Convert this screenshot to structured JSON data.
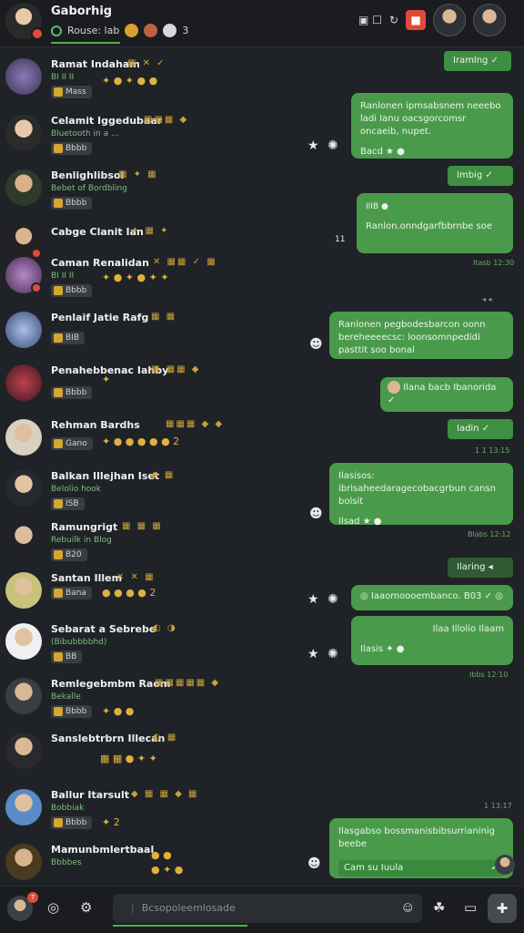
{
  "header": {
    "title": "Gaborhig",
    "status": "Rouse: lab",
    "status_count": "3",
    "icons": [
      "image-icon",
      "search-icon",
      "camera-icon",
      "red-badge-icon"
    ]
  },
  "chats": [
    {
      "name": "Ramat Indaham",
      "sub": "BI II II",
      "chip": "Mass"
    },
    {
      "name": "Celamit Iggedubaar",
      "sub": "Bluetooth in a ...",
      "chip": "Bbbb"
    },
    {
      "name": "Benlighlibsol",
      "sub": "Bebet of Bordbling",
      "chip": "Bbbb"
    },
    {
      "name": "Cabge Clanit Ian",
      "sub": "",
      "chip": ""
    },
    {
      "name": "Caman Renalidan",
      "sub": "BI II II",
      "chip": "Bbbb"
    },
    {
      "name": "Penlaif Jatie Rafg",
      "sub": "",
      "chip": "BIB"
    },
    {
      "name": "Penahebbenac Iahby",
      "sub": "",
      "chip": "Bbbb"
    },
    {
      "name": "Rehman Bardhs",
      "sub": "",
      "chip": "Gano"
    },
    {
      "name": "Balkan Illejhan Iset",
      "sub": "Belolio hook",
      "chip": "ISB"
    },
    {
      "name": "Ramungrigt",
      "sub": "Rebuilk in Blog",
      "chip": "B20"
    },
    {
      "name": "Santan Illem",
      "sub": "",
      "chip": "Bana"
    },
    {
      "name": "Sebarat a Sebrebe",
      "sub": "(Bibubbbbhd)",
      "chip": "BB"
    },
    {
      "name": "Remlegebmbm Raom",
      "sub": "Bekalle",
      "chip": "Bbbb"
    },
    {
      "name": "Sanslebtrbrn Illecan",
      "sub": "",
      "chip": ""
    },
    {
      "name": "Ballur Itarsult",
      "sub": "Bobbiak",
      "chip": "Bbbb"
    },
    {
      "name": "Mamunbmlertbaal",
      "sub": "Bbbbes",
      "chip": ""
    }
  ],
  "messages": [
    {
      "text": "Iramlng",
      "ts": ""
    },
    {
      "text": "Ranlonen ipmsabsnem neeebo ladi Ianu oacsgorcomsr oncaeib, nupet.",
      "extra": "Bacd",
      "ts": ""
    },
    {
      "text": "Imbig",
      "ts": ""
    },
    {
      "text": "Ranlon.onndgarfbbrnbe soe",
      "extra": "IIIB",
      "ts": "Itasb 12:30"
    },
    {
      "text": "Ranlonen pegbodesbarcon oonn bereheeeecsc: loonsomnpedidi pasttit soo bonal",
      "ts": ""
    },
    {
      "text": "Ilana bacb Ibanorida",
      "ts": ""
    },
    {
      "text": "Iadin",
      "ts": "1 1 13:15"
    },
    {
      "text": "Ilasisos: ibrisaheedaragecobacgrbun cansn bolsit",
      "extra": "Ilsad",
      "ts": "Blabs 12:12"
    },
    {
      "text": "Ilaring",
      "ts": ""
    },
    {
      "text": "Iaaomoooembanco.",
      "extra": "B03",
      "ts": ""
    },
    {
      "text": "Ilaa Illolio Ilaam",
      "extra": "Ilasis",
      "ts": "Ibbs 12:10"
    },
    {
      "text": "Ilasgabso bossmanisbibsurrianinig beebe",
      "extra": "Cam su Iuula",
      "ts": "1 13:17"
    }
  ],
  "compose": {
    "placeholder": "Bcsopoleemlosade"
  },
  "bottom": {
    "badge": "7"
  }
}
